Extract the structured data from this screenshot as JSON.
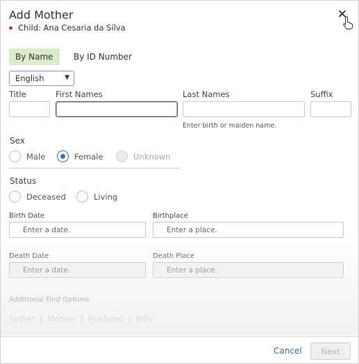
{
  "dialog": {
    "title": "Add Mother",
    "child_label": "Child: Ana Cesaria da Silva",
    "close_glyph": "✕"
  },
  "tabs": [
    {
      "label": "By Name",
      "active": true
    },
    {
      "label": "By ID Number",
      "active": false
    }
  ],
  "language": {
    "selected": "English"
  },
  "name_fields": {
    "title_label": "Title",
    "first_label": "First Names",
    "last_label": "Last Names",
    "suffix_label": "Suffix",
    "last_hint": "Enter birth or maiden name."
  },
  "sex": {
    "heading": "Sex",
    "options": [
      "Male",
      "Female",
      "Unknown"
    ],
    "selected": "Female"
  },
  "status": {
    "heading": "Status",
    "options": [
      "Deceased",
      "Living"
    ]
  },
  "events": {
    "birth_date_label": "Birth Date",
    "birth_date_placeholder": "Enter a date.",
    "birthplace_label": "Birthplace",
    "birthplace_placeholder": "Enter a place.",
    "death_date_label": "Death Date",
    "death_date_placeholder": "Enter a date.",
    "death_place_label": "Death Place",
    "death_place_placeholder": "Enter a place."
  },
  "find": {
    "heading": "Additional Find Options",
    "links": [
      "Father",
      "Mother",
      "Husband",
      "Wife"
    ],
    "separator": "|"
  },
  "footer": {
    "cancel_label": "Cancel",
    "next_label": "Next"
  },
  "colors": {
    "accent_blue": "#2e6fd0",
    "tab_active_bg": "#dcebc8",
    "child_dot": "#d0305c"
  }
}
